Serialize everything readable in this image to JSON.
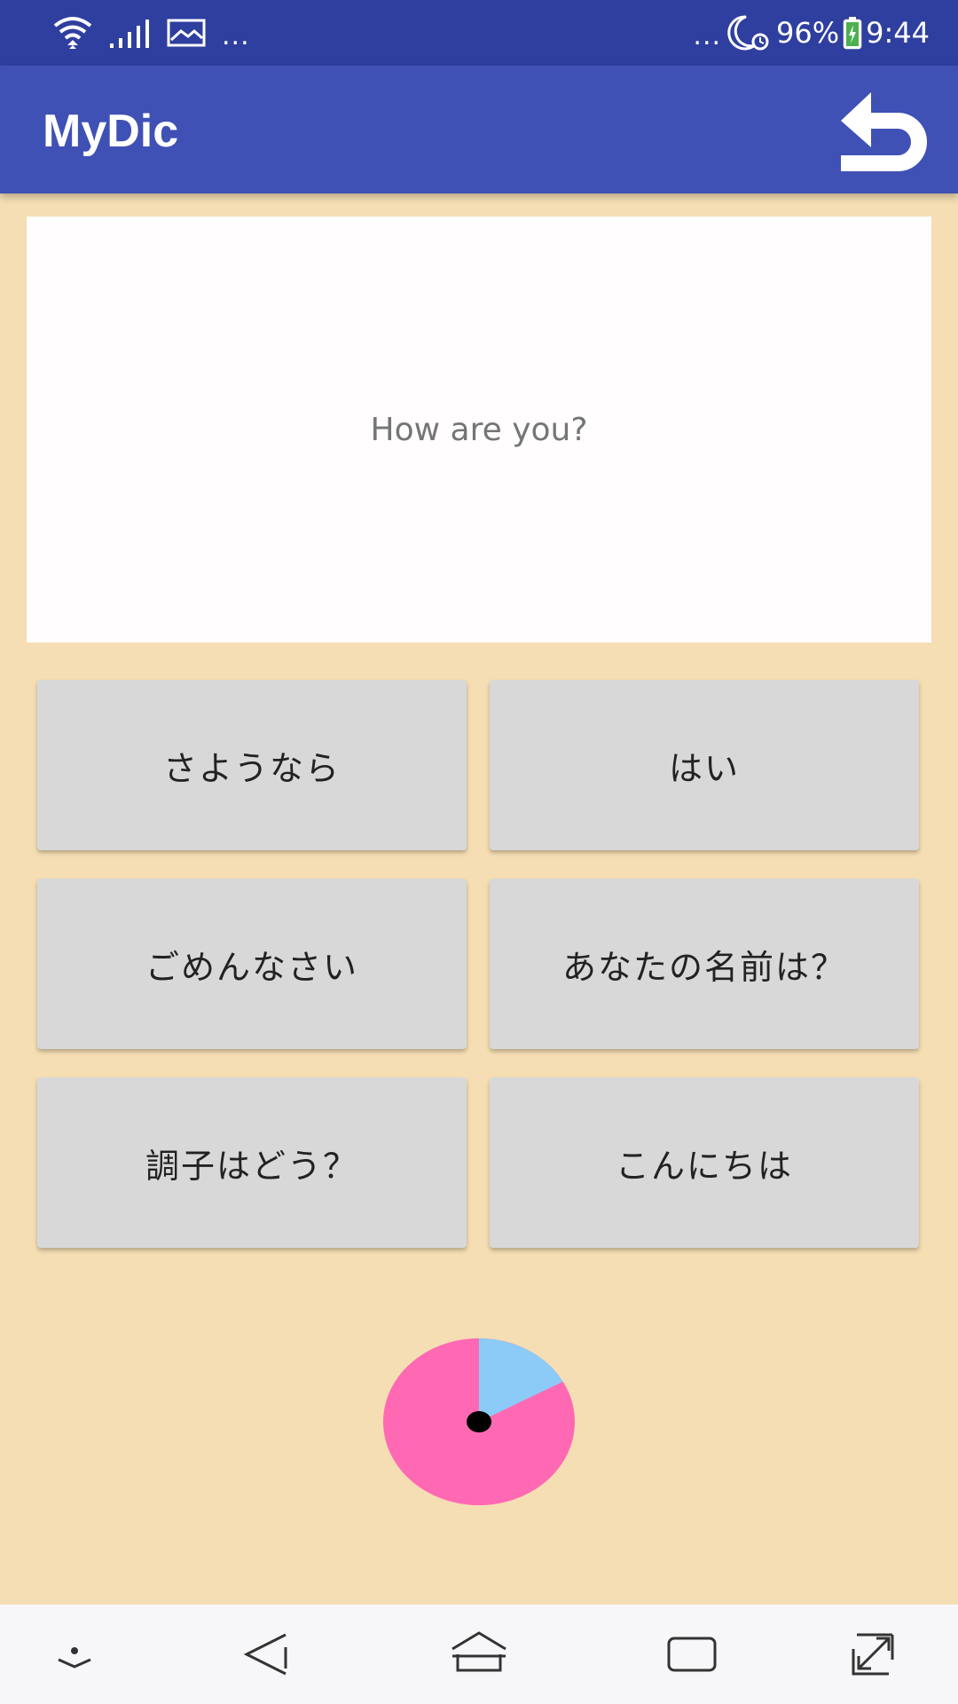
{
  "status_bar": {
    "left_dots": "...",
    "right_dots": "...",
    "battery": "96%",
    "time": "9:44",
    "icons": [
      "wifi-icon",
      "signal-icon",
      "image-icon",
      "moon-icon",
      "alarm-icon",
      "battery-icon"
    ]
  },
  "app_bar": {
    "title": "MyDic",
    "back_icon": "return-icon"
  },
  "question": {
    "text": "How are you?"
  },
  "answers": [
    {
      "label": "さようなら"
    },
    {
      "label": "はい"
    },
    {
      "label": "ごめんなさい"
    },
    {
      "label": "あなたの名前は？"
    },
    {
      "label": "調子はどう？"
    },
    {
      "label": "こんにちは"
    }
  ],
  "timer": {
    "elapsed_fraction": 0.17,
    "colors": {
      "elapsed": "#8ccbf7",
      "remaining": "#ff69b4",
      "center": "#000000"
    }
  },
  "nav_bar": {
    "icons": [
      "collapse-icon",
      "back-icon",
      "home-icon",
      "recents-icon",
      "expand-icon"
    ]
  },
  "colors": {
    "status_bar": "#2f3f9f",
    "app_bar": "#3f51b5",
    "background": "#f5deb3",
    "button": "#d8d8d8"
  }
}
